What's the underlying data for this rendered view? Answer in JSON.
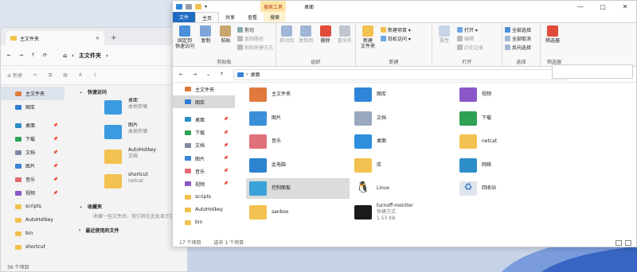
{
  "back": {
    "tab_title": "主文件夹",
    "tab_close": "✕",
    "tab_add": "+",
    "address": "主文件夹",
    "new_label": "新建",
    "sidebar": [
      {
        "label": "主文件夹",
        "icon": "home-icon",
        "selected": true
      },
      {
        "label": "图库",
        "icon": "gallery-icon"
      },
      {
        "label": "桌面",
        "icon": "desktop-folder-icon",
        "pinned": true
      },
      {
        "label": "下载",
        "icon": "downloads-folder-icon",
        "pinned": true
      },
      {
        "label": "文档",
        "icon": "documents-folder-icon",
        "pinned": true
      },
      {
        "label": "图片",
        "icon": "pictures-folder-icon",
        "pinned": true
      },
      {
        "label": "音乐",
        "icon": "music-folder-icon",
        "pinned": true
      },
      {
        "label": "视频",
        "icon": "videos-folder-icon",
        "pinned": true
      },
      {
        "label": "scripts",
        "icon": "folder-icon"
      },
      {
        "label": "AutoHotkey",
        "icon": "folder-icon"
      },
      {
        "label": "bin",
        "icon": "folder-icon"
      },
      {
        "label": "shortcut",
        "icon": "folder-icon"
      }
    ],
    "quick_access_title": "快速访问",
    "quick_access": [
      {
        "name": "桌面",
        "sub": "本地存储",
        "color": "#3b9be0"
      },
      {
        "name": "图片",
        "sub": "本地存储",
        "color": "#3b9be0"
      },
      {
        "name": "AutoHotkey",
        "sub": "文档",
        "color": "#f3c14f"
      },
      {
        "name": "shortcut",
        "sub": "netcat",
        "color": "#f3c14f"
      }
    ],
    "favorites_title": "收藏夹",
    "favorites_hint": "收藏一些文件后，我们将在此处显示它们。",
    "recent_title": "最近使用的文件",
    "status": "36 个项目"
  },
  "front": {
    "context_tab": "搜索工具",
    "title": "桌面",
    "controls": {
      "min": "—",
      "max": "▢",
      "close": "✕"
    },
    "ribbon_tabs": [
      "文件",
      "主页",
      "共享",
      "查看",
      "搜索"
    ],
    "groups": {
      "clipboard": {
        "name": "剪贴板",
        "pin": "固定到\n快速访问",
        "copy": "复制",
        "paste": "粘贴",
        "cut": "剪切",
        "copy_path": "复制路径",
        "paste_shortcut": "粘贴快捷方式"
      },
      "organize": {
        "name": "组织",
        "move": "移动到",
        "copy_to": "复制到",
        "delete": "删除",
        "rename": "重命名"
      },
      "new": {
        "name": "新建",
        "new_folder": "新建\n文件夹",
        "new_item": "新建项目 ▾",
        "easy_access": "轻松访问 ▾"
      },
      "open": {
        "name": "打开",
        "properties": "属性",
        "open": "打开 ▾",
        "edit": "编辑",
        "history": "历史记录"
      },
      "select": {
        "name": "选择",
        "select_all": "全部选择",
        "select_none": "全部取消",
        "invert": "反向选择"
      },
      "filter": {
        "name": "筛选器",
        "filter": "筛选器"
      }
    },
    "address": "桌面",
    "sidebar": [
      {
        "label": "主文件夹",
        "icon": "home-icon"
      },
      {
        "label": "图库",
        "icon": "gallery-icon",
        "selected": true
      },
      {
        "label": "桌面",
        "icon": "desktop-folder-icon",
        "pinned": true
      },
      {
        "label": "下载",
        "icon": "downloads-folder-icon",
        "pinned": true
      },
      {
        "label": "文档",
        "icon": "documents-folder-icon",
        "pinned": true
      },
      {
        "label": "图片",
        "icon": "pictures-folder-icon",
        "pinned": true
      },
      {
        "label": "音乐",
        "icon": "music-folder-icon",
        "pinned": true
      },
      {
        "label": "视频",
        "icon": "videos-folder-icon",
        "pinned": true
      },
      {
        "label": "scripts",
        "icon": "folder-icon"
      },
      {
        "label": "AutoHotkey",
        "icon": "folder-icon"
      },
      {
        "label": "bin",
        "icon": "folder-icon"
      }
    ],
    "items": [
      {
        "name": "主文件夹",
        "icon": "home-icon",
        "color": "#e07a3c"
      },
      {
        "name": "图片",
        "icon": "pictures-folder-icon",
        "color": "#3b8fd9"
      },
      {
        "name": "音乐",
        "icon": "music-folder-icon",
        "color": "#e0707a"
      },
      {
        "name": "此电脑",
        "icon": "computer-icon",
        "color": "#2d83cf"
      },
      {
        "name": "控制面板",
        "icon": "control-panel-icon",
        "color": "#3aa2d8",
        "highlight": true
      },
      {
        "name": "sanbox",
        "icon": "folder-icon",
        "color": "#f3c14f"
      },
      {
        "name": "图库",
        "icon": "gallery-icon",
        "color": "#2f86d8"
      },
      {
        "name": "文档",
        "icon": "documents-folder-icon",
        "color": "#9aa9bf"
      },
      {
        "name": "桌面",
        "icon": "desktop-folder-icon",
        "color": "#2f8fdc"
      },
      {
        "name": "库",
        "icon": "libraries-icon",
        "color": "#f3c14f"
      },
      {
        "name": "Linux",
        "icon": "linux-icon",
        "color": "#ffffff"
      },
      {
        "name": "turnoff-monitor",
        "sub1": "快捷方式",
        "sub2": "1.53 KB",
        "icon": "shortcut-icon",
        "color": "#1b1b1b"
      },
      {
        "name": "视频",
        "icon": "videos-folder-icon",
        "color": "#8a58c9"
      },
      {
        "name": "下载",
        "icon": "downloads-folder-icon",
        "color": "#2fa155"
      },
      {
        "name": "netcat",
        "icon": "folder-icon",
        "color": "#f3c14f"
      },
      {
        "name": "网络",
        "icon": "network-icon",
        "color": "#2d8fc7"
      },
      {
        "name": "回收站",
        "icon": "recycle-bin-icon",
        "color": "#dfe6ee"
      }
    ],
    "status_count": "17 个项目",
    "status_selected": "选中 1 个项目"
  }
}
